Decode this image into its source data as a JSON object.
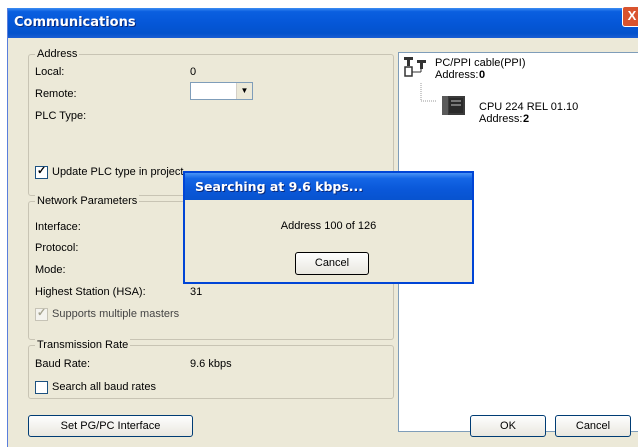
{
  "window": {
    "title": "Communications",
    "close_glyph": "X"
  },
  "address_group": {
    "title": "Address",
    "local_label": "Local:",
    "local_value": "0",
    "remote_label": "Remote:",
    "remote_value": "",
    "plc_type_label": "PLC Type:",
    "update_plc_label": "Update PLC type in project",
    "update_plc_checked": true
  },
  "network_group": {
    "title": "Network Parameters",
    "interface_label": "Interface:",
    "protocol_label": "Protocol:",
    "mode_label": "Mode:",
    "hsa_label": "Highest Station (HSA):",
    "hsa_value": "31",
    "multiple_masters_label": "Supports multiple masters",
    "multiple_masters_checked": true
  },
  "transmission_group": {
    "title": "Transmission Rate",
    "baud_label": "Baud Rate:",
    "baud_value": "9.6 kbps",
    "search_all_label": "Search all baud rates",
    "search_all_checked": false
  },
  "tree": {
    "cable_name": "PC/PPI cable(PPI)",
    "cable_address_label": "Address:",
    "cable_address_value": "0",
    "cpu_name": "CPU 224 REL 01.10",
    "cpu_address_label": "Address:",
    "cpu_address_value": "2"
  },
  "search_dialog": {
    "title": "Searching at 9.6 kbps...",
    "progress_text": "Address 100 of 126",
    "cancel_label": "Cancel"
  },
  "footer": {
    "set_interface_label": "Set PG/PC Interface",
    "ok_label": "OK",
    "cancel_label": "Cancel"
  },
  "icons": {
    "cable": "pc-ppi-cable-icon",
    "cpu": "cpu-module-icon",
    "dropdown": "chevron-down-icon",
    "check": "checkmark-icon"
  },
  "colors": {
    "titlebar": "#0557d8",
    "dialog_bg": "#ece9d8",
    "close_button": "#d9532e"
  }
}
